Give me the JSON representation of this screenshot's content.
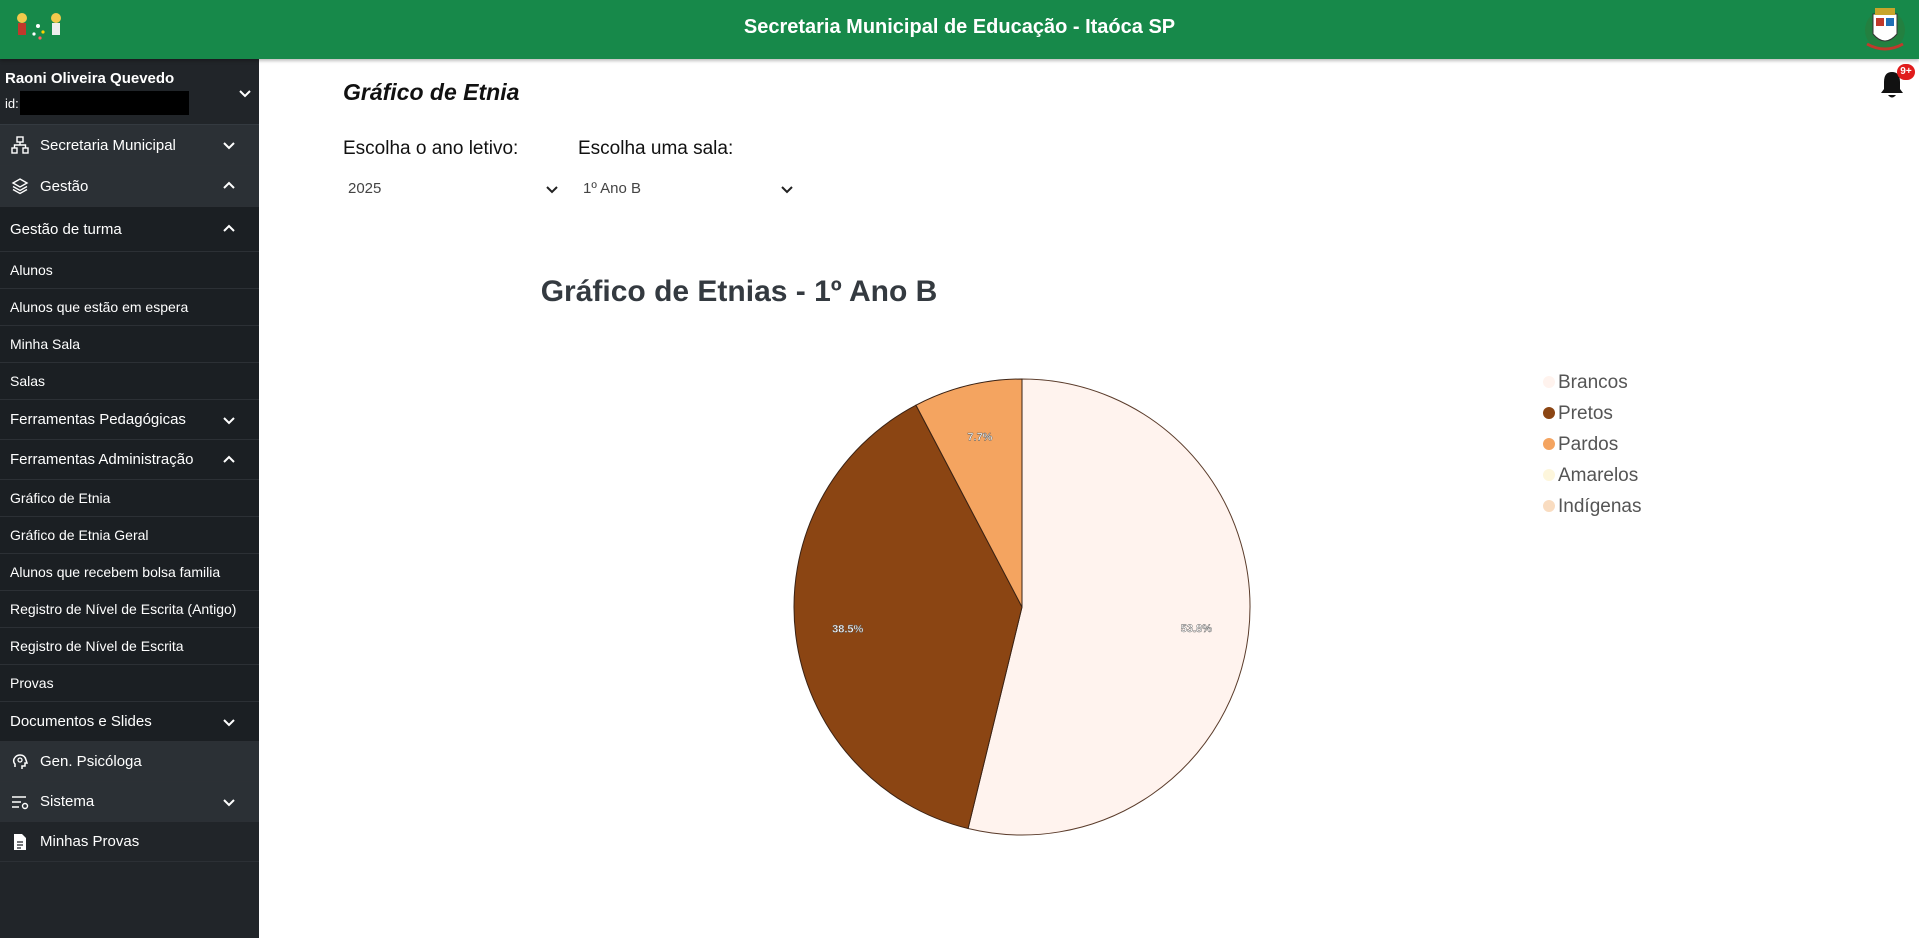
{
  "header": {
    "title": "Secretaria Municipal de Educação - Itaóca SP",
    "logo_left": "school-children-logo",
    "logo_right": "municipal-coat-of-arms"
  },
  "user": {
    "name": "Raoni Oliveira Quevedo",
    "id_label": "id:"
  },
  "sidebar": {
    "items": [
      {
        "label": "Secretaria Municipal",
        "icon": "sitemap-icon",
        "expanded": false
      },
      {
        "label": "Gestão",
        "icon": "layers-icon",
        "expanded": true
      },
      {
        "label": "Gestão de turma",
        "expanded": true
      },
      {
        "label": "Alunos"
      },
      {
        "label": "Alunos que estão em espera"
      },
      {
        "label": "Minha Sala"
      },
      {
        "label": "Salas"
      },
      {
        "label": "Ferramentas Pedagógicas",
        "expanded": false
      },
      {
        "label": "Ferramentas Administração",
        "expanded": true
      },
      {
        "label": "Gráfico de Etnia"
      },
      {
        "label": "Gráfico de Etnia Geral"
      },
      {
        "label": "Alunos que recebem bolsa familia"
      },
      {
        "label": "Registro de Nível de Escrita (Antigo)"
      },
      {
        "label": "Registro de Nível de Escrita"
      },
      {
        "label": "Provas"
      },
      {
        "label": "Documentos e Slides",
        "expanded": false
      },
      {
        "label": "Gen. Psicóloga",
        "icon": "brain-head-icon"
      },
      {
        "label": "Sistema",
        "icon": "list-settings-icon",
        "expanded": false
      },
      {
        "label": "Minhas Provas",
        "icon": "document-icon"
      }
    ]
  },
  "main": {
    "page_title": "Gráfico de Etnia",
    "notifications_badge": "9+",
    "year_label": "Escolha o ano letivo:",
    "year_value": "2025",
    "room_label": "Escolha uma sala:",
    "room_value": "1º Ano B"
  },
  "chart_data": {
    "type": "pie",
    "title": "Gráfico de Etnias - 1º Ano B",
    "categories": [
      "Brancos",
      "Pretos",
      "Pardos",
      "Amarelos",
      "Indígenas"
    ],
    "values": [
      53.8,
      38.5,
      7.7,
      0,
      0
    ],
    "data_labels": [
      "53.8%",
      "38.5%",
      "7.7%",
      "",
      ""
    ],
    "colors": [
      "#fff3ee",
      "#8b4513",
      "#f4a460",
      "#fdf6dc",
      "#f9dcc0"
    ],
    "legend_position": "right"
  }
}
